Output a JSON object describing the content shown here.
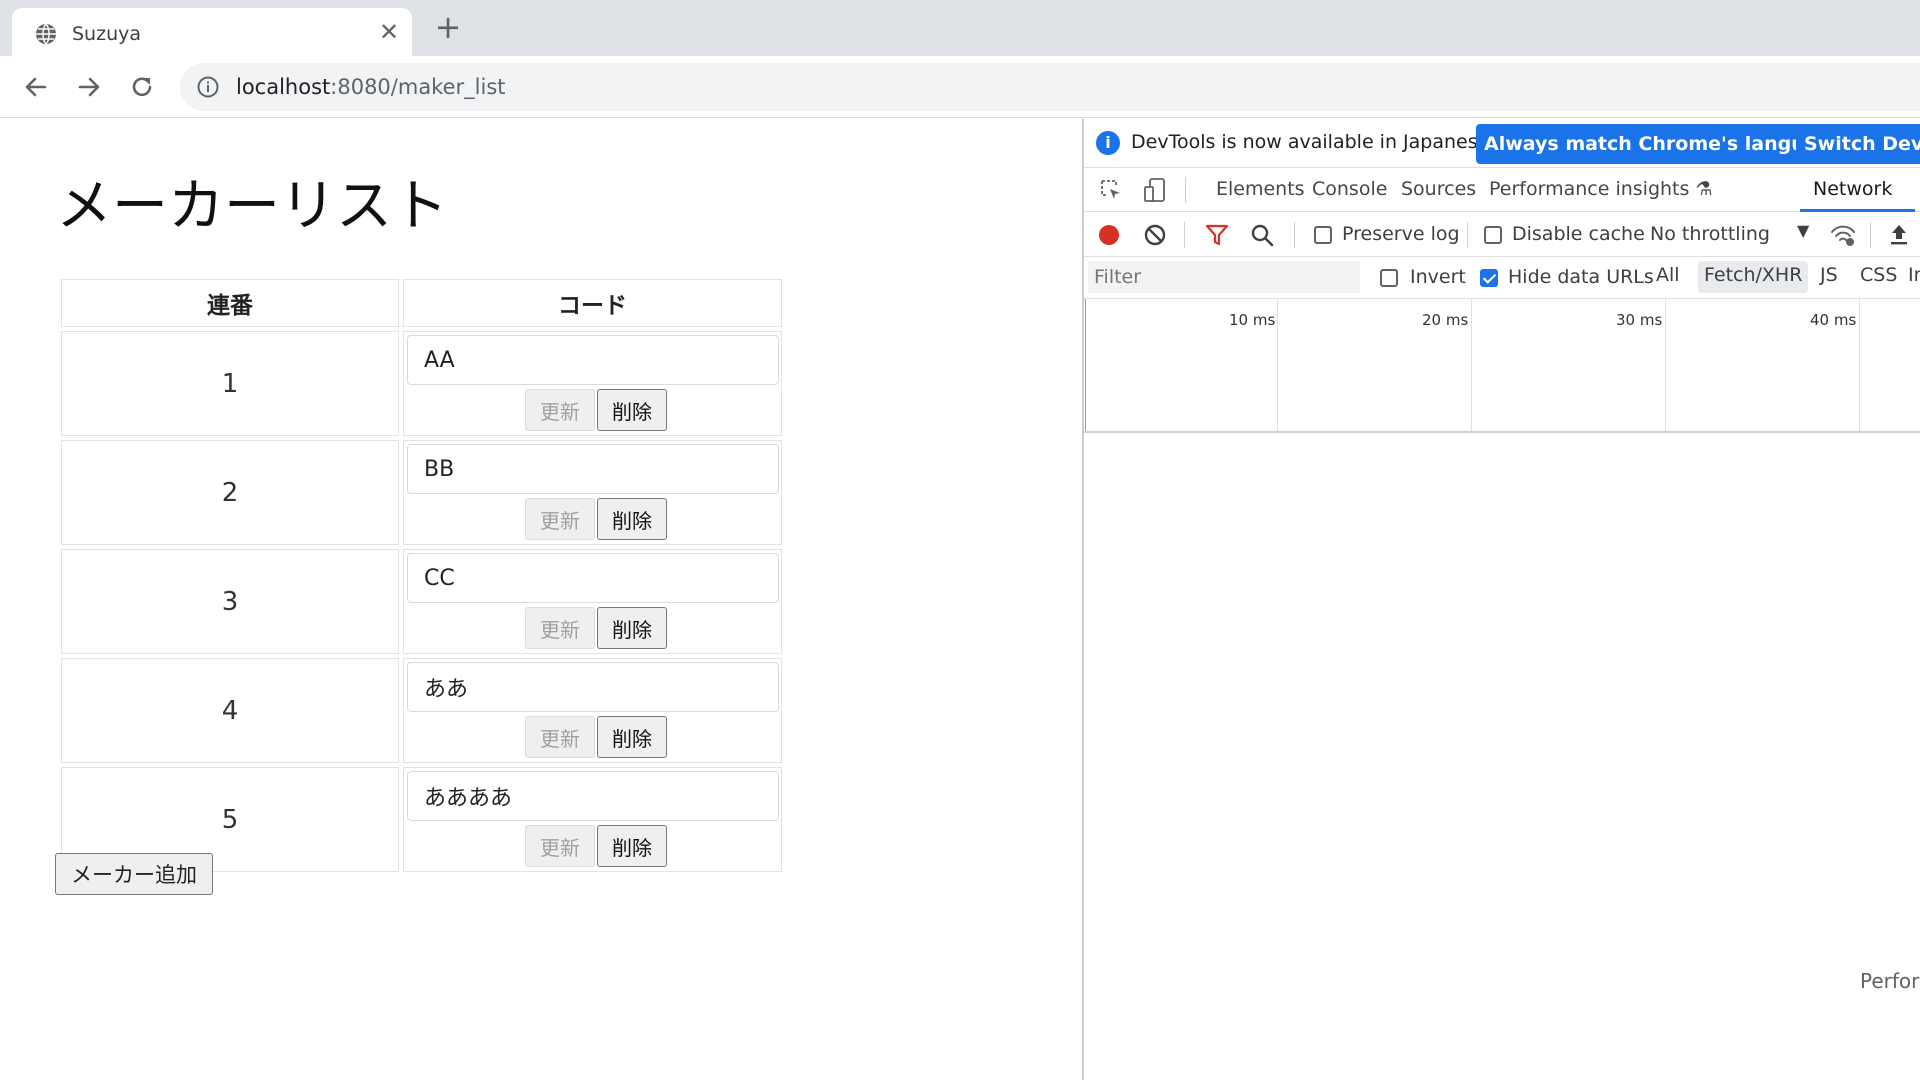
{
  "browser": {
    "tab_title": "Suzuya",
    "url_host": "localhost",
    "url_path": ":8080/maker_list"
  },
  "page": {
    "title": "メーカーリスト",
    "table": {
      "headers": [
        "連番",
        "コード"
      ],
      "rows": [
        {
          "no": "1",
          "code": "AA"
        },
        {
          "no": "2",
          "code": "BB"
        },
        {
          "no": "3",
          "code": "CC"
        },
        {
          "no": "4",
          "code": "ああ"
        },
        {
          "no": "5",
          "code": "ああああ"
        }
      ],
      "update_label": "更新",
      "delete_label": "削除"
    },
    "add_button_label": "メーカー追加"
  },
  "devtools": {
    "info_text": "DevTools is now available in Japanese!",
    "info_btn_match": "Always match Chrome's language",
    "info_btn_switch": "Switch DevTo",
    "tabs": [
      "Elements",
      "Console",
      "Sources",
      "Performance insights",
      "Network"
    ],
    "active_tab": "Network",
    "preserve_log": "Preserve log",
    "disable_cache": "Disable cache",
    "throttling": "No throttling",
    "filter_placeholder": "Filter",
    "invert": "Invert",
    "hide_data_urls": "Hide data URLs",
    "type_filters": [
      "All",
      "Fetch/XHR",
      "JS",
      "CSS",
      "Im"
    ],
    "active_type": "Fetch/XHR",
    "ticks": [
      "10 ms",
      "20 ms",
      "30 ms",
      "40 ms"
    ],
    "footer_text": "Perfor",
    "record_color": "#d93025",
    "accent_color": "#1a73e8"
  }
}
